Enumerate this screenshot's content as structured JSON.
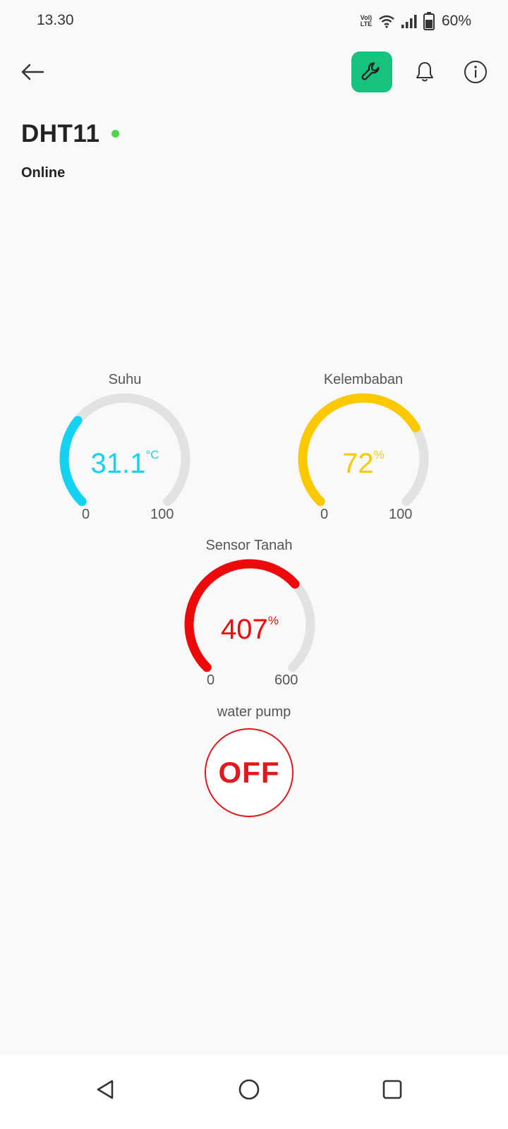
{
  "status_bar": {
    "time": "13.30",
    "volte_top": "Vol)",
    "volte_bottom": "LTE",
    "battery_pct": "60%",
    "icons": [
      "volte-icon",
      "wifi-icon",
      "signal-icon",
      "battery-icon"
    ]
  },
  "header": {
    "back_icon": "arrow-left-icon",
    "wrench_icon": "wrench-icon",
    "bell_icon": "bell-icon",
    "info_icon": "info-icon",
    "accent_color": "#17c17e"
  },
  "device": {
    "name": "DHT11",
    "status": "Online",
    "status_color": "#4fd54b"
  },
  "gauges": [
    {
      "label": "Suhu",
      "value": 31.1,
      "value_text": "31.1",
      "unit": "°C",
      "min": "0",
      "max": "100",
      "color": "#13d2f2"
    },
    {
      "label": "Kelembaban",
      "value": 72,
      "value_text": "72",
      "unit": "%",
      "min": "0",
      "max": "100",
      "color": "#fcc800"
    },
    {
      "label": "Sensor Tanah",
      "value": 407,
      "value_text": "407",
      "unit": "%",
      "min": "0",
      "max": "600",
      "color": "#ee0a0a"
    }
  ],
  "pump": {
    "label": "water pump",
    "state": "OFF",
    "color": "#e0191e"
  },
  "nav": {
    "icons": [
      "back-triangle-icon",
      "home-circle-icon",
      "recents-square-icon"
    ]
  }
}
